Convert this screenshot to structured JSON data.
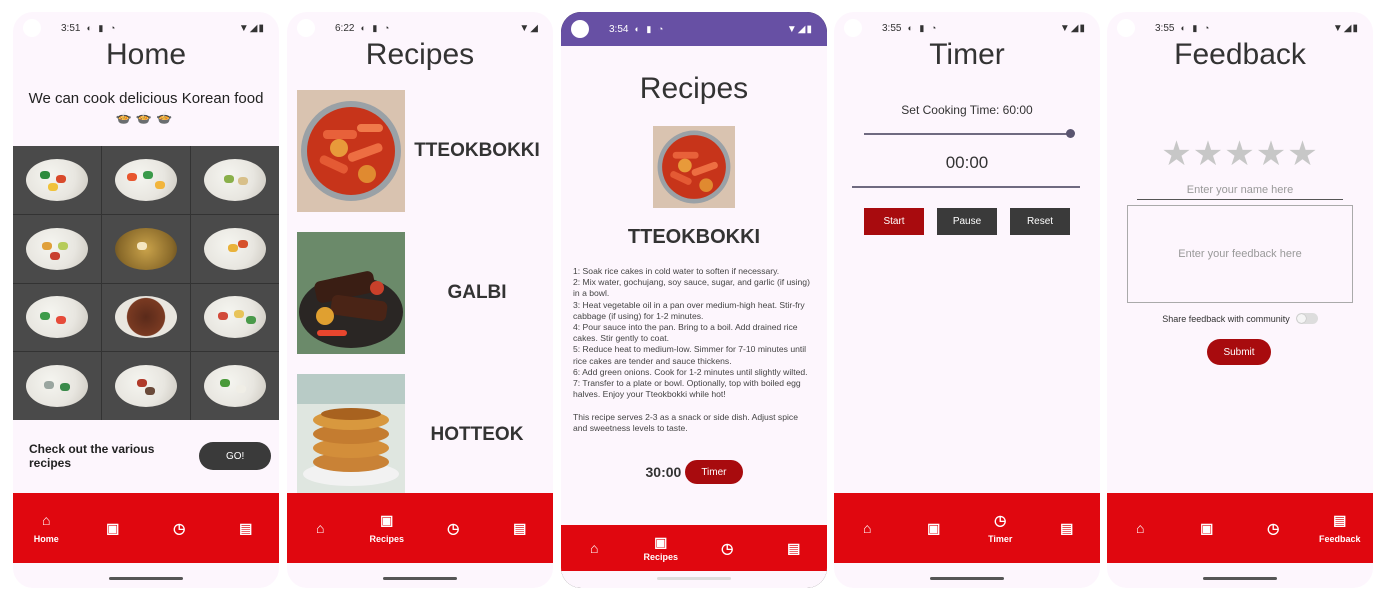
{
  "home": {
    "status_time": "3:51",
    "title": "Home",
    "subtitle": "We can cook delicious Korean food",
    "emoji": "🍲🍲🍲",
    "check_text": "Check out the various recipes",
    "go_label": "GO!"
  },
  "recipes": {
    "status_time": "6:22",
    "title": "Recipes",
    "items": [
      {
        "name": "TTEOKBOKKI"
      },
      {
        "name": "GALBI"
      },
      {
        "name": "HOTTEOK"
      }
    ]
  },
  "detail": {
    "status_time": "3:54",
    "title": "Recipes",
    "name": "TTEOKBOKKI",
    "steps": "1: Soak rice cakes in cold water to soften if necessary.\n2: Mix water, gochujang, soy sauce, sugar, and garlic (if using) in a bowl.\n3: Heat vegetable oil in a pan over medium-high heat. Stir-fry cabbage (if using) for 1-2 minutes.\n4: Pour sauce into the pan. Bring to a boil. Add drained rice cakes. Stir gently to coat.\n5: Reduce heat to medium-low. Simmer for 7-10 minutes until rice cakes are tender and sauce thickens.\n6: Add green onions. Cook for 1-2 minutes until slightly wilted.\n7: Transfer to a plate or bowl. Optionally, top with boiled egg halves. Enjoy your Tteokbokki while hot!\n\nThis recipe serves 2-3 as a snack or side dish. Adjust spice and sweetness levels to taste.",
    "time_value": "30:00",
    "timer_label": "Timer"
  },
  "timer": {
    "status_time": "3:55",
    "title": "Timer",
    "set_time": "Set Cooking Time: 60:00",
    "slider_fraction": 1.0,
    "display": "00:00",
    "start_label": "Start",
    "pause_label": "Pause",
    "reset_label": "Reset"
  },
  "feedback": {
    "status_time": "3:55",
    "title": "Feedback",
    "stars": "★★★★★",
    "rating": 0,
    "name_placeholder": "Enter your name here",
    "feedback_placeholder": "Enter your feedback here",
    "share_label": "Share feedback with community",
    "share_on": false,
    "submit_label": "Submit"
  },
  "nav": {
    "home_label": "Home",
    "recipes_label": "Recipes",
    "timer_label": "Timer",
    "feedback_label": "Feedback"
  },
  "colors": {
    "nav_red": "#e0070f",
    "button_red": "#a80b0e",
    "button_dark": "#3a3a3a",
    "status_purple": "#6750a4",
    "screen_bg": "#fdf6fd"
  },
  "icons": {
    "home": "home-icon",
    "recipes": "recipe-book-icon",
    "timer": "timer-icon",
    "feedback": "feedback-icon"
  }
}
